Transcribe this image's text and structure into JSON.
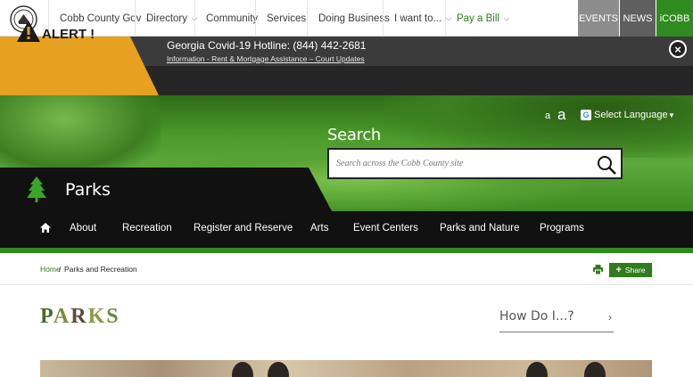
{
  "topnav": {
    "items": [
      {
        "label": "Cobb County Gov",
        "has_dropdown": true
      },
      {
        "label": "Directory",
        "has_dropdown": true
      },
      {
        "label": "Community",
        "has_dropdown": false
      },
      {
        "label": "Services",
        "has_dropdown": false
      },
      {
        "label": "Doing Business",
        "has_dropdown": false
      },
      {
        "label": "I want to...",
        "has_dropdown": true
      },
      {
        "label": "Pay a Bill",
        "has_dropdown": true
      }
    ],
    "events_label": "EVENTS",
    "news_label": "NEWS",
    "icobb_label": "iCOBB"
  },
  "alert": {
    "label": "ALERT !",
    "hotline": "Georgia Covid-19 Hotline: (844) 442-2681",
    "links": "Information - Rent & Mortgage Assistance – Court Updates",
    "close_glyph": "×"
  },
  "hero": {
    "font_small": "a",
    "font_large": "a",
    "language_label": "Select Language",
    "language_caret": "▼",
    "google_glyph": "G",
    "search_title": "Search",
    "search_placeholder": "Search across the Cobb County site",
    "department": "Parks"
  },
  "deptnav": {
    "items": [
      "About",
      "Recreation",
      "Register and Reserve",
      "Arts",
      "Event Centers",
      "Parks and Nature",
      "Programs"
    ]
  },
  "breadcrumb": {
    "home": "Home",
    "separator": "/",
    "current": "Parks and Recreation"
  },
  "share": {
    "plus": "+",
    "label": "Share"
  },
  "content": {
    "heading_letters": [
      "P",
      "A",
      "R",
      "K",
      "S"
    ],
    "howdoi_label": "How Do I...?",
    "howdoi_chevron": "›"
  },
  "colors": {
    "brand_green": "#2f8a1f",
    "alert_orange": "#e8a020",
    "nav_dark": "#111111",
    "events_gray": "#8c8c8c",
    "news_gray": "#5f5f5f"
  },
  "icons": [
    "county-seal-icon",
    "chevron-down-icon",
    "alert-triangle-icon",
    "close-icon",
    "google-translate-icon",
    "search-icon",
    "pine-tree-icon",
    "home-icon",
    "print-icon",
    "plus-icon"
  ]
}
